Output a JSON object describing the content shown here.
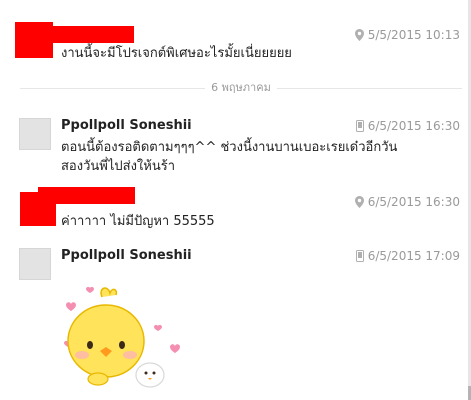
{
  "messages": [
    {
      "id": "m1",
      "sender": "",
      "avatar": "redacted",
      "meta_icon": "location-pin-icon",
      "timestamp": "5/5/2015 10:13",
      "lines": [
        "งานนี้จะมีโปรเจกต์พิเศษอะไรมั้ยเนี่ยยยยย"
      ]
    },
    {
      "id": "m2",
      "sender": "Ppollpoll Soneshii",
      "avatar": "placeholder",
      "meta_icon": "phone-icon",
      "timestamp": "6/5/2015 16:30",
      "lines": [
        "ตอนนี้ต้องรอติดตามๆๆๆ^^ ช่วงนี้งานบานเบอะเรยเด๋วอีกวัน",
        "สองวันพี่ไปส่งให้นร้า"
      ]
    },
    {
      "id": "m3",
      "sender": "",
      "avatar": "redacted",
      "meta_icon": "location-pin-icon",
      "timestamp": "6/5/2015 16:30",
      "lines": [
        "ค่าาาาา ไม่มีปัญหา 55555"
      ]
    },
    {
      "id": "m4",
      "sender": "Ppollpoll Soneshii",
      "avatar": "placeholder",
      "meta_icon": "phone-icon",
      "timestamp": "6/5/2015 17:09",
      "lines": [],
      "sticker": "yellow-chick-sticker"
    }
  ],
  "date_divider": {
    "label": "6 พฤษภาคม"
  },
  "colors": {
    "redaction": "#ff0000",
    "meta_text": "#9a9a9a",
    "divider_line": "#e6e6e6",
    "avatar_placeholder": "#e3e3e3"
  }
}
